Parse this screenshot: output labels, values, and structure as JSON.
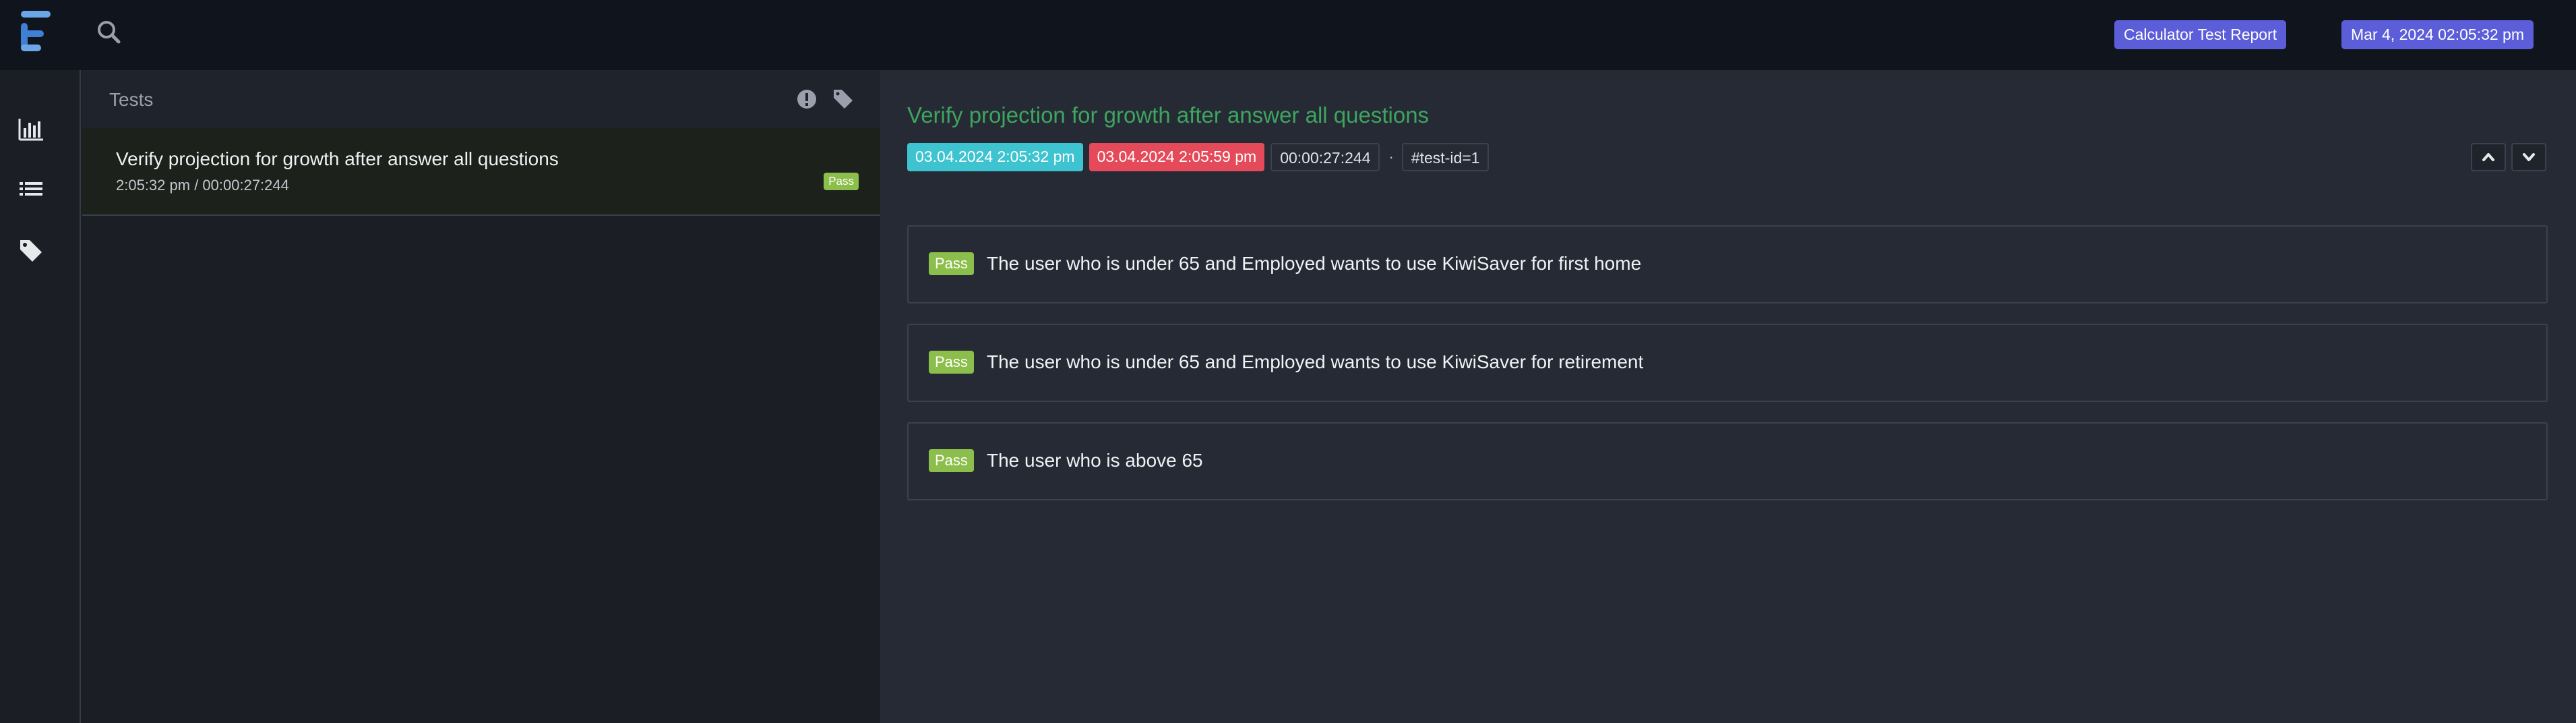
{
  "header": {
    "report_name": "Calculator Test Report",
    "report_date": "Mar 4, 2024 02:05:32 pm",
    "accent_color": "#5b5ed8"
  },
  "sidebar": {
    "items": [
      {
        "icon": "bar-chart-icon"
      },
      {
        "icon": "list-icon"
      },
      {
        "icon": "tag-icon"
      }
    ]
  },
  "tests_panel": {
    "title": "Tests",
    "tests": [
      {
        "name": "Verify projection for growth after answer all questions",
        "meta": "2:05:32 pm / 00:00:27:244",
        "status": "Pass"
      }
    ]
  },
  "detail": {
    "title": "Verify projection for growth after answer all questions",
    "start_time": "03.04.2024 2:05:32 pm",
    "end_time": "03.04.2024 2:05:59 pm",
    "duration": "00:00:27:244",
    "separator": "·",
    "test_id": "#test-id=1",
    "steps": [
      {
        "status": "Pass",
        "text": "The user who is under 65 and Employed wants to use KiwiSaver for first home"
      },
      {
        "status": "Pass",
        "text": "The user who is under 65 and Employed wants to use KiwiSaver for retirement"
      },
      {
        "status": "Pass",
        "text": "The user who is above 65"
      }
    ]
  },
  "colors": {
    "pass": "#8cbe4b",
    "start_chip": "#3dc4d0",
    "end_chip": "#e44a5a",
    "title_green": "#3ea55f"
  }
}
